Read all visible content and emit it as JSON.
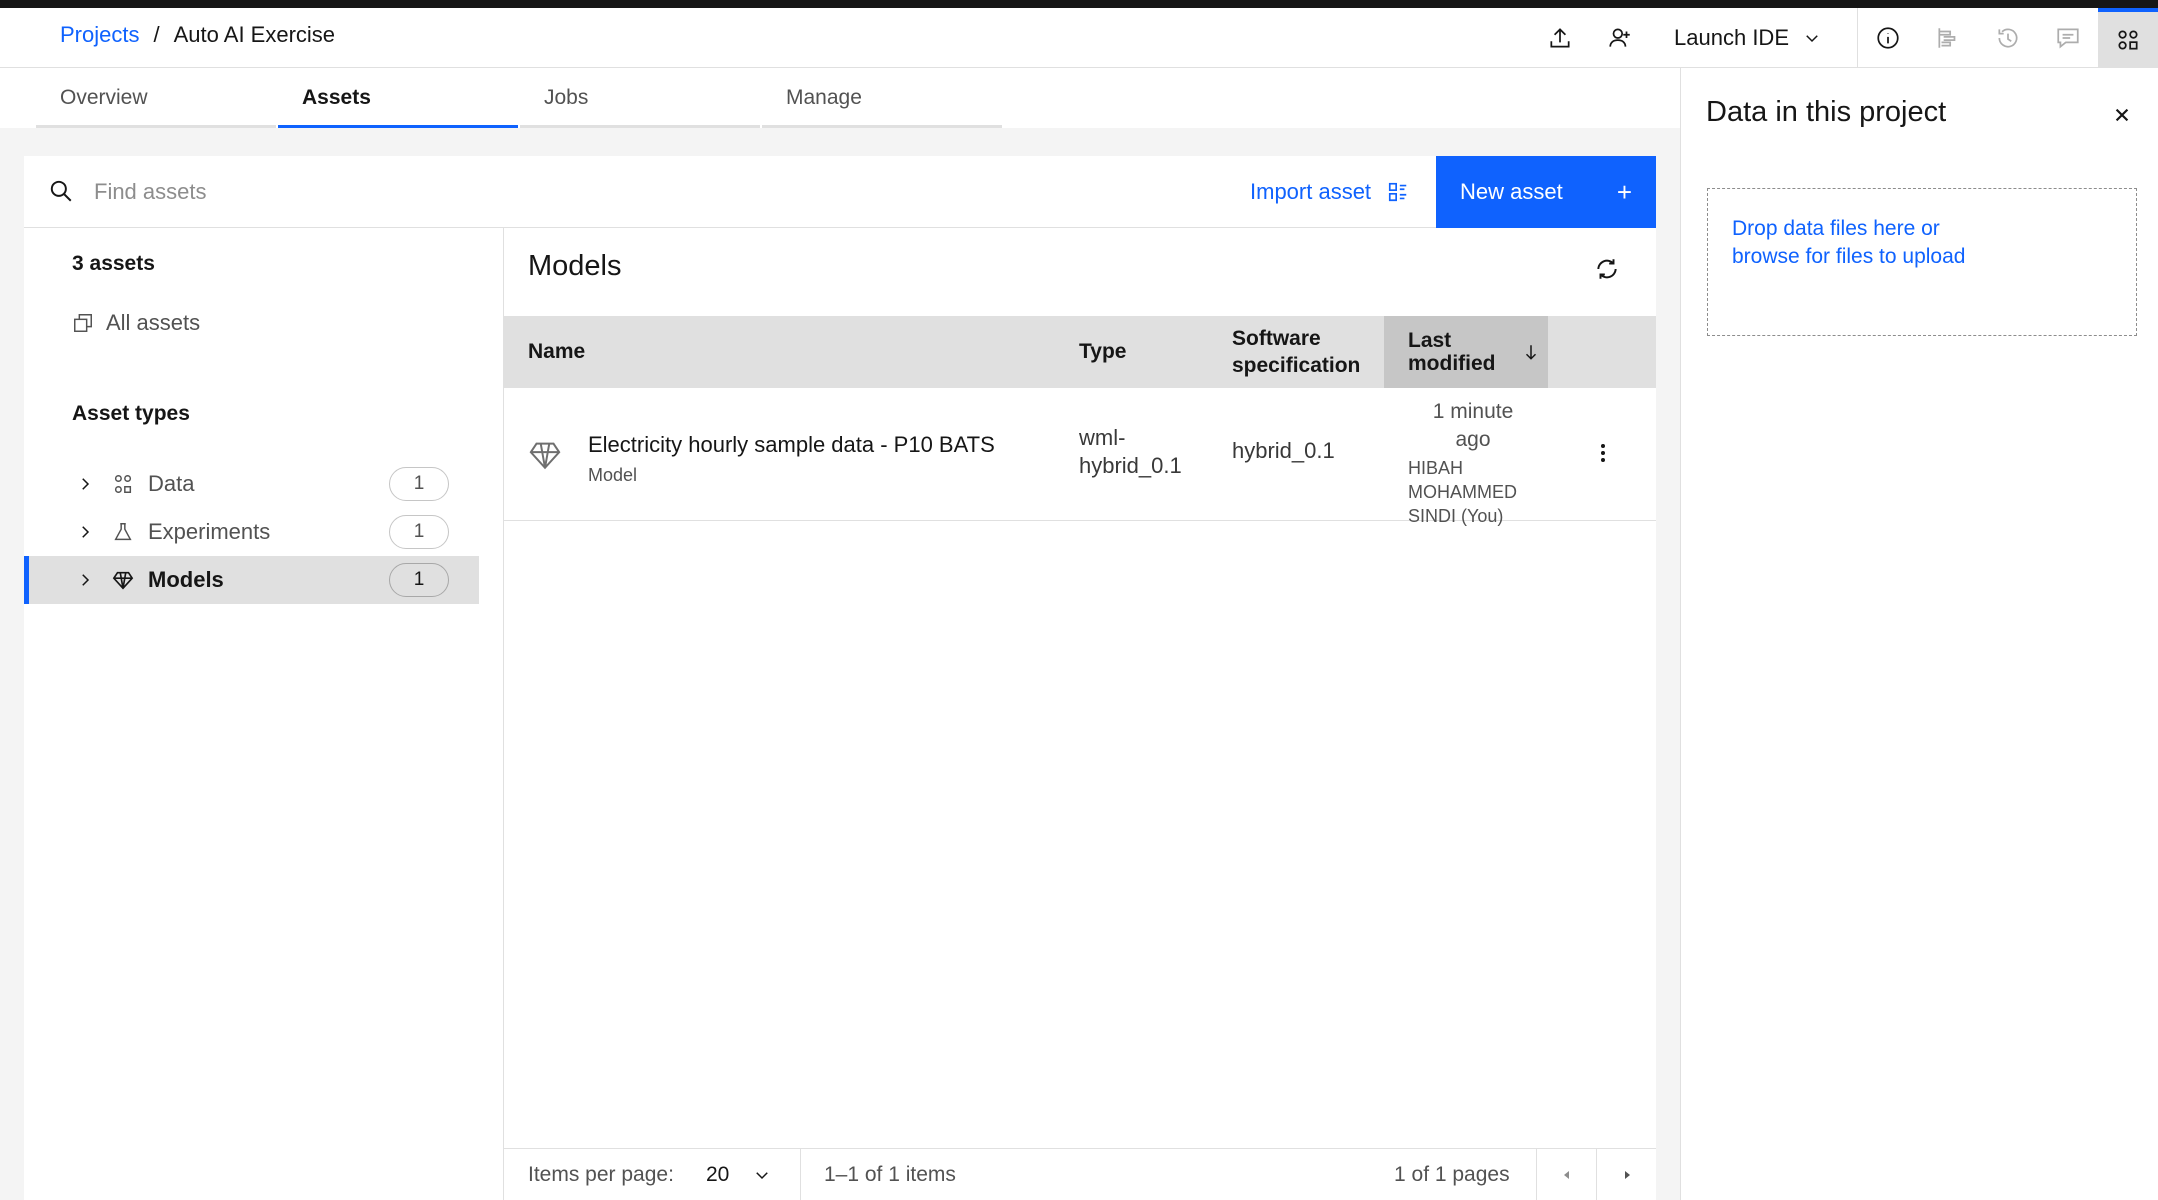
{
  "header": {
    "breadcrumb_link": "Projects",
    "breadcrumb_sep": "/",
    "breadcrumb_current": "Auto AI Exercise",
    "launch_ide": "Launch IDE",
    "icons": [
      "upload-icon",
      "add-user-icon",
      "chevron-down-icon",
      "info-icon",
      "gantt-icon",
      "history-icon",
      "comment-icon",
      "data-panel-icon"
    ]
  },
  "tabs": [
    {
      "label": "Overview"
    },
    {
      "label": "Assets"
    },
    {
      "label": "Jobs"
    },
    {
      "label": "Manage"
    }
  ],
  "toolbar": {
    "search_placeholder": "Find assets",
    "import_label": "Import asset",
    "new_asset_label": "New asset",
    "new_asset_plus": "+"
  },
  "sidebar": {
    "count_title": "3 assets",
    "all_assets": "All assets",
    "types_title": "Asset types",
    "types": [
      {
        "label": "Data",
        "count": "1"
      },
      {
        "label": "Experiments",
        "count": "1"
      },
      {
        "label": "Models",
        "count": "1"
      }
    ]
  },
  "content": {
    "title": "Models",
    "columns": {
      "name": "Name",
      "type": "Type",
      "spec_line1": "Software",
      "spec_line2": "specification",
      "mod_line1": "Last",
      "mod_line2": "modified"
    },
    "rows": [
      {
        "name": "Electricity hourly sample data - P10 BATS",
        "sub": "Model",
        "type_line1": "wml-",
        "type_line2": "hybrid_0.1",
        "spec": "hybrid_0.1",
        "mod_line1": "1 minute",
        "mod_line2": "ago",
        "user_line1": "HIBAH",
        "user_line2": "MOHAMMED",
        "user_line3": "SINDI (You)"
      }
    ],
    "pager": {
      "items_per_page_label": "Items per page:",
      "items_per_page_value": "20",
      "range": "1–1 of 1 items",
      "pages": "1 of 1 pages"
    }
  },
  "right_panel": {
    "title": "Data in this project",
    "drop_line1": "Drop data files here or",
    "drop_line2": "browse for files to upload"
  },
  "colors": {
    "accent": "#0f62fe",
    "selected_bg": "#e0e0e0",
    "page_bg": "#f4f4f4"
  }
}
